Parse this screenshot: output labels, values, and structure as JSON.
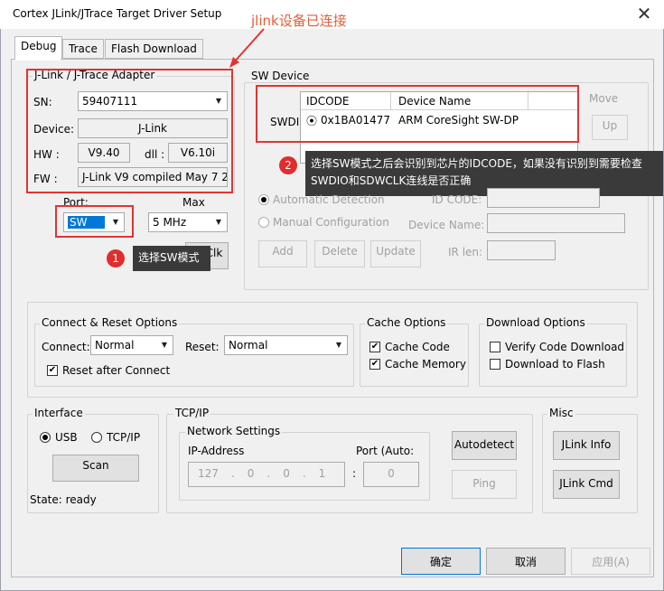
{
  "window": {
    "title": "Cortex JLink/JTrace Target Driver Setup",
    "close": "✕"
  },
  "tabs": [
    "Debug",
    "Trace",
    "Flash Download"
  ],
  "annotation": {
    "text": "jlink设备已连接"
  },
  "adapter": {
    "group": "J-Link / J-Trace Adapter",
    "sn_label": "SN:",
    "sn_value": "59407111",
    "device_label": "Device:",
    "device_value": "J-Link",
    "hw_label": "HW :",
    "hw_value": "V9.40",
    "dll_label": "dll :",
    "dll_value": "V6.10i",
    "fw_label": "FW :",
    "fw_value": "J-Link V9 compiled May  7 2",
    "port_label": "Port:",
    "port_value": "SW",
    "max_label": "Max",
    "max_value": "5 MHz",
    "clk_partial": "Clk"
  },
  "tips": [
    {
      "num": "1",
      "text": "选择SW模式"
    },
    {
      "num": "2",
      "text": "选择SW模式之后会识别到芯片的IDCODE，如果没有识别到需要检查SWDIO和SDWCLK连线是否正确"
    }
  ],
  "sw_device": {
    "group": "SW Device",
    "swdi_label": "SWDI",
    "columns": [
      "IDCODE",
      "Device Name"
    ],
    "rows": [
      {
        "idcode": "0x1BA01477",
        "name": "ARM CoreSight SW-DP"
      }
    ],
    "move_label": "Move",
    "up_label": "Up",
    "auto_label": "Automatic Detection",
    "manual_label": "Manual Configuration",
    "id_code_label": "ID CODE:",
    "device_name_label": "Device Name:",
    "ir_len_label": "IR len:",
    "add": "Add",
    "delete": "Delete",
    "update": "Update"
  },
  "connect": {
    "group": "Connect & Reset Options",
    "connect_label": "Connect:",
    "connect_value": "Normal",
    "reset_label": "Reset:",
    "reset_value": "Normal",
    "reset_after": "Reset after Connect"
  },
  "cache": {
    "group": "Cache Options",
    "code": "Cache Code",
    "memory": "Cache Memory"
  },
  "download": {
    "group": "Download Options",
    "verify": "Verify Code Download",
    "flash": "Download to Flash"
  },
  "interface": {
    "group": "Interface",
    "usb": "USB",
    "tcpip": "TCP/IP",
    "scan": "Scan",
    "state": "State: ready"
  },
  "tcp": {
    "group": "TCP/IP",
    "net_group": "Network Settings",
    "ip_label": "IP-Address",
    "port_label": "Port (Auto:",
    "ip": [
      "127",
      ".",
      "0",
      ".",
      "0",
      ".",
      "1"
    ],
    "port_value": "0",
    "autodetect": "Autodetect",
    "ping": "Ping"
  },
  "misc": {
    "group": "Misc",
    "info": "JLink Info",
    "cmd": "JLink Cmd"
  },
  "footer": {
    "ok": "确定",
    "cancel": "取消",
    "apply": "应用(A)"
  }
}
